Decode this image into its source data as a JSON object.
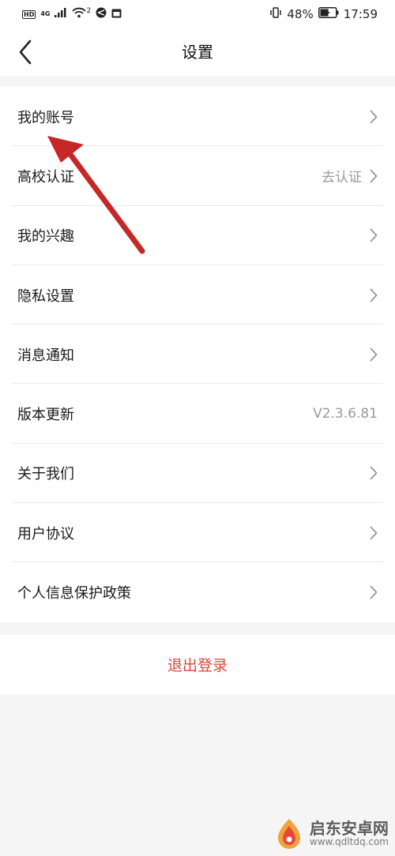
{
  "status_bar": {
    "hd": "HD",
    "network": "4G",
    "network_sub": "46",
    "wifi_sup": "2",
    "battery_percent": "48%",
    "time": "17:59"
  },
  "nav": {
    "title": "设置"
  },
  "settings": {
    "items": [
      {
        "label": "我的账号",
        "value": ""
      },
      {
        "label": "高校认证",
        "value": "去认证"
      },
      {
        "label": "我的兴趣",
        "value": ""
      },
      {
        "label": "隐私设置",
        "value": ""
      },
      {
        "label": "消息通知",
        "value": ""
      },
      {
        "label": "版本更新",
        "value": "V2.3.6.81"
      },
      {
        "label": "关于我们",
        "value": ""
      },
      {
        "label": "用户协议",
        "value": ""
      },
      {
        "label": "个人信息保护政策",
        "value": ""
      }
    ]
  },
  "logout": {
    "label": "退出登录",
    "color": "#d9473b"
  },
  "annotation": {
    "color": "#c62828"
  },
  "watermark": {
    "title": "启东安卓网",
    "url": "www.qdltdq.com"
  },
  "icons": [
    "back-arrow-icon",
    "chevron-right-icon",
    "wifi-icon",
    "signal-icon",
    "battery-icon",
    "vibrate-icon"
  ]
}
